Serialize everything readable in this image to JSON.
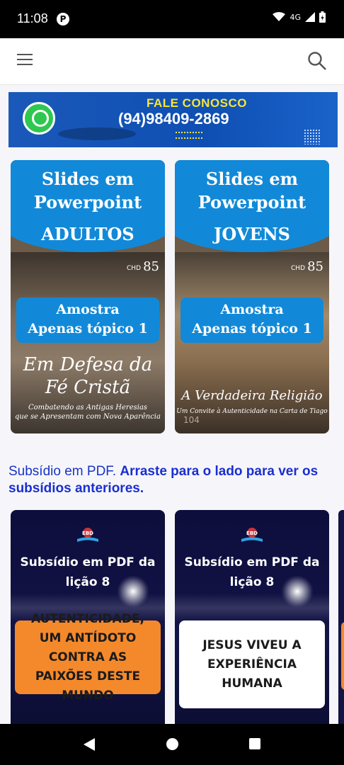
{
  "status_bar": {
    "time": "11:08",
    "network": "4G"
  },
  "banner": {
    "title": "FALE CONOSCO",
    "phone": "(94)98409-2869"
  },
  "slides": [
    {
      "line1": "Slides em",
      "line2": "Powerpoint",
      "audience": "ADULTOS",
      "sample_line1": "Amostra",
      "sample_line2": "Apenas tópico 1",
      "headline1": "Em Defesa da",
      "headline2": "Fé Cristã",
      "subtitle1": "Combatendo as Antigas Heresias",
      "subtitle2": "que se Apresentam com Nova Aparência",
      "badge": "ADULTOS"
    },
    {
      "line1": "Slides em",
      "line2": "Powerpoint",
      "audience": "JOVENS",
      "sample_line1": "Amostra",
      "sample_line2": "Apenas tópico 1",
      "headline1": "A Verdadeira Religião",
      "subtitle1": "Um Convite à Autenticidade na Carta de Tiago",
      "views": "104"
    }
  ],
  "subsidio": {
    "lead": "Subsídio em PDF.",
    "instruction": "Arraste para o lado para ver os subsídios anteriores."
  },
  "pdf_cards": [
    {
      "logo": "EBD",
      "title1": "Subsídio em PDF da",
      "title2": "lição 8",
      "topic": "AUTENTICIDADE, UM ANTÍDOTO CONTRA AS PAIXÕES DESTE MUNDO"
    },
    {
      "logo": "EBD",
      "title1": "Subsídio em PDF da",
      "title2": "lição 8",
      "topic": "JESUS VIVEU A EXPERIÊNCIA HUMANA"
    }
  ],
  "colors": {
    "accent_blue": "#1289d8",
    "link_blue": "#1a2fd0",
    "orange": "#f4892b"
  }
}
